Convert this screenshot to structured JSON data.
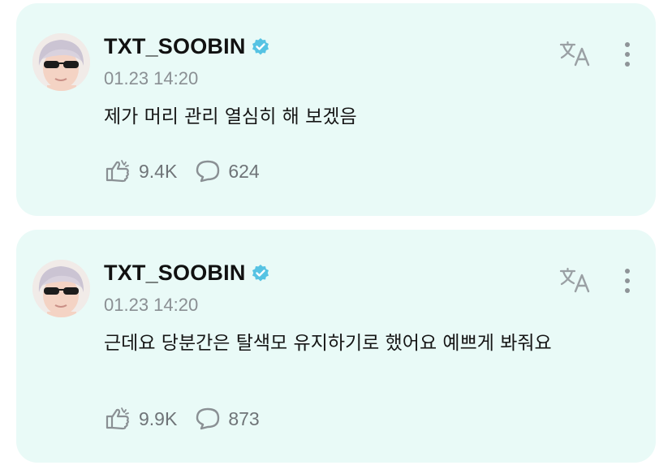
{
  "posts": [
    {
      "author": "TXT_SOOBIN",
      "verified": true,
      "timestamp": "01.23 14:20",
      "text": "제가 머리 관리 열심히 해 보겠음",
      "likes": "9.4K",
      "comments": "624"
    },
    {
      "author": "TXT_SOOBIN",
      "verified": true,
      "timestamp": "01.23 14:20",
      "text": "근데요 당분간은 탈색모 유지하기로 했어요 예쁘게 봐줘요",
      "likes": "9.9K",
      "comments": "873"
    }
  ],
  "icons": {
    "translate": "translate-icon",
    "more": "more-vertical-icon",
    "like": "like-hand-icon",
    "comment": "comment-bubble-icon",
    "verified": "verified-badge-icon"
  },
  "colors": {
    "card_background": "#e9faf7",
    "verified_badge": "#56c3e3",
    "muted_text": "#8a8f93"
  }
}
